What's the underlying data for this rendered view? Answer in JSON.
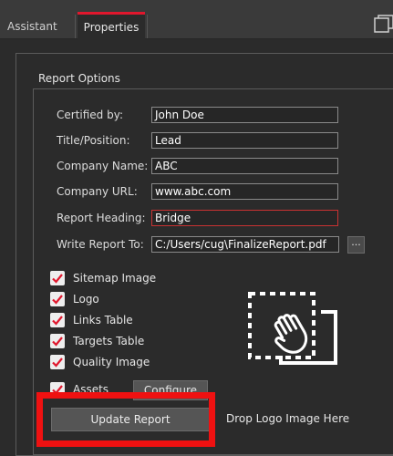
{
  "tabs": [
    {
      "label": "Assistant",
      "active": false
    },
    {
      "label": "Properties",
      "active": true
    }
  ],
  "group": {
    "title": "Report Options"
  },
  "fields": [
    {
      "label": "Certified by:",
      "value": "John Doe",
      "invalid": false
    },
    {
      "label": "Title/Position:",
      "value": "Lead",
      "invalid": false
    },
    {
      "label": "Company Name:",
      "value": "ABC",
      "invalid": false
    },
    {
      "label": "Company URL:",
      "value": "www.abc.com",
      "invalid": false
    },
    {
      "label": "Report Heading:",
      "value": "Bridge",
      "invalid": true
    },
    {
      "label": "Write Report To:",
      "value": "C:/Users/cug\\FinalizeReport.pdf",
      "invalid": false
    }
  ],
  "browse_label": "...",
  "checkboxes": [
    {
      "label": "Sitemap Image",
      "checked": true
    },
    {
      "label": "Logo",
      "checked": true
    },
    {
      "label": "Links Table",
      "checked": true
    },
    {
      "label": "Targets Table",
      "checked": true
    },
    {
      "label": "Quality Image",
      "checked": true
    },
    {
      "label": "Assets",
      "checked": true
    }
  ],
  "configure_label": "Configure",
  "update_label": "Update Report",
  "drop_label": "Drop Logo Image Here",
  "icons": {
    "window": "window-icon",
    "drop": "drag-hand-icon",
    "check": "checkmark-icon"
  },
  "colors": {
    "accent_tab": "#e0172d",
    "invalid_border": "#c83232",
    "checkbox_mark": "#e0172d",
    "annotation": "#ef1111"
  }
}
